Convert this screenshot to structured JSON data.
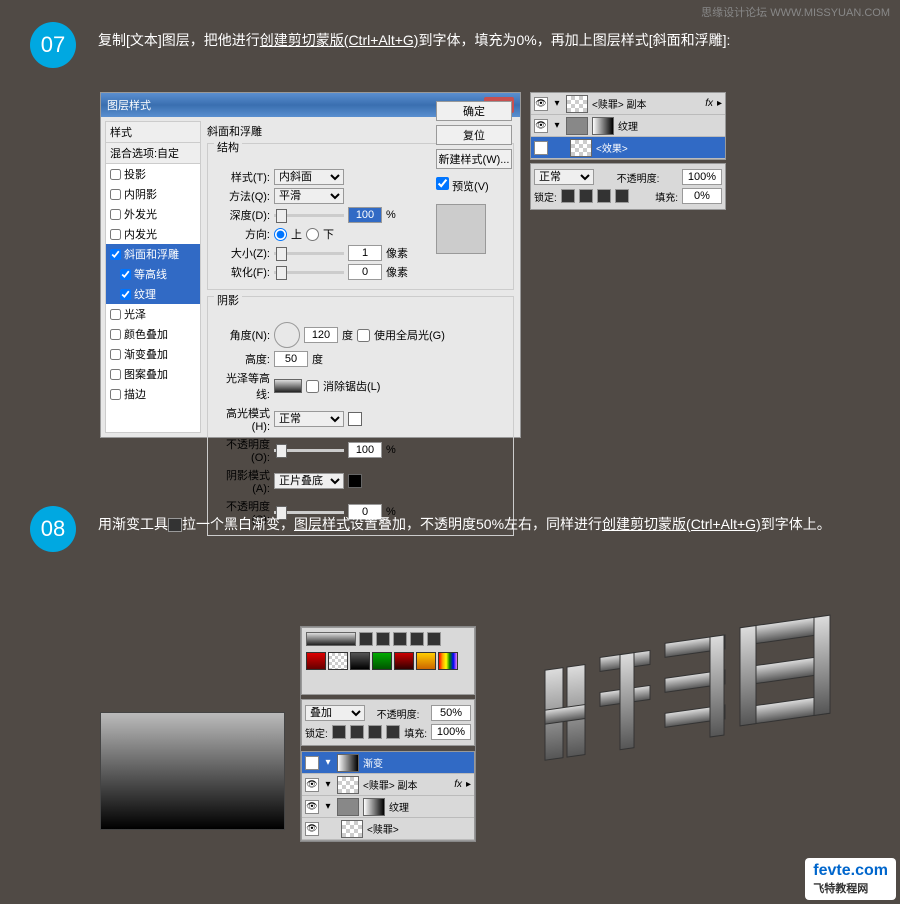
{
  "watermark": "思缘设计论坛 WWW.MISSYUAN.COM",
  "step07": {
    "num": "07",
    "text_a": "复制[文本]图层，把他进行",
    "text_b": "创建剪切蒙版(Ctrl+Alt+G)",
    "text_c": "到字体，填充为0%，再加上图层样式[斜面和浮雕]:"
  },
  "step08": {
    "num": "08",
    "text_a": "用渐变工具",
    "text_b": "拉一个黑白渐变，",
    "text_c": "图层样式",
    "text_d": "设置叠加，不透明度50%左右，同样进行",
    "text_e": "创建剪切蒙版(Ctrl+Alt+G)",
    "text_f": "到字体上。"
  },
  "dialog": {
    "title": "图层样式",
    "close": "×",
    "styles_hdr": "样式",
    "blend_hdr": "混合选项:自定",
    "items": [
      "投影",
      "内阴影",
      "外发光",
      "内发光",
      "斜面和浮雕",
      "等高线",
      "纹理",
      "光泽",
      "颜色叠加",
      "渐变叠加",
      "图案叠加",
      "描边"
    ],
    "section": "斜面和浮雕",
    "structure": "结构",
    "style_l": "样式(T):",
    "style_v": "内斜面",
    "method_l": "方法(Q):",
    "method_v": "平滑",
    "depth_l": "深度(D):",
    "depth_v": "100",
    "pct": "%",
    "dir_l": "方向:",
    "dir_up": "上",
    "dir_down": "下",
    "size_l": "大小(Z):",
    "size_v": "1",
    "px": "像素",
    "soft_l": "软化(F):",
    "soft_v": "0",
    "shadow": "阴影",
    "angle_l": "角度(N):",
    "angle_v": "120",
    "deg": "度",
    "global": "使用全局光(G)",
    "alt_l": "高度:",
    "alt_v": "50",
    "gloss_l": "光泽等高线:",
    "anti": "消除锯齿(L)",
    "hl_l": "高光模式(H):",
    "hl_v": "正常",
    "op_l": "不透明度(O):",
    "op_v": "100",
    "sh_l": "阴影模式(A):",
    "sh_v": "正片叠底",
    "op2_l": "不透明度(C):",
    "op2_v": "0",
    "btn_ok": "确定",
    "btn_cancel": "复位",
    "btn_new": "新建样式(W)...",
    "preview": "预览(V)"
  },
  "layers": {
    "l1": "<赎罪> 副本",
    "l2": "纹理",
    "l3": "<效果>",
    "mode": "正常",
    "op_l": "不透明度:",
    "op_v": "100%",
    "lock_l": "锁定:",
    "fill_l": "填充:",
    "fill_v": "0%",
    "fx": "fx"
  },
  "panel2": {
    "mode": "叠加",
    "op_l": "不透明度:",
    "op_v": "50%",
    "lock_l": "锁定:",
    "fill_l": "填充:",
    "fill_v": "100%",
    "l1": "渐变",
    "l2": "<赎罪> 副本",
    "l3": "纹理",
    "l4": "<赎罪>",
    "fx": "fx"
  },
  "logo": {
    "main": "fevte.com",
    "sub": "飞特教程网"
  }
}
